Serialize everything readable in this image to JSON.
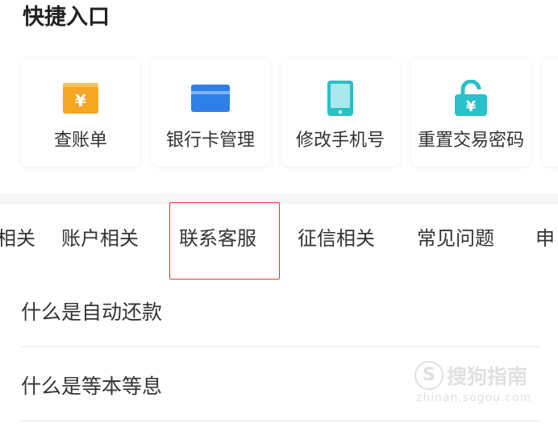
{
  "quick_entry": {
    "title": "快捷入口",
    "items": [
      {
        "label": "查账单",
        "icon": "bill-icon",
        "color": "#f5a623"
      },
      {
        "label": "银行卡管理",
        "icon": "bank-card-icon",
        "color": "#2f7fe8"
      },
      {
        "label": "修改手机号",
        "icon": "phone-icon",
        "color": "#2bbfc8"
      },
      {
        "label": "重置交易密码",
        "icon": "lock-icon",
        "color": "#2bbfc8"
      }
    ]
  },
  "faq_tabs": {
    "items": [
      {
        "label": "相关"
      },
      {
        "label": "账户相关"
      },
      {
        "label": "联系客服"
      },
      {
        "label": "征信相关"
      },
      {
        "label": "常见问题"
      },
      {
        "label": "申"
      }
    ],
    "highlighted_index": 2
  },
  "faq_list": {
    "items": [
      {
        "label": "什么是自动还款"
      },
      {
        "label": "什么是等本等息"
      }
    ]
  },
  "watermark": {
    "brand": "搜狗指南",
    "domain": "zhinan.sogou.com"
  }
}
